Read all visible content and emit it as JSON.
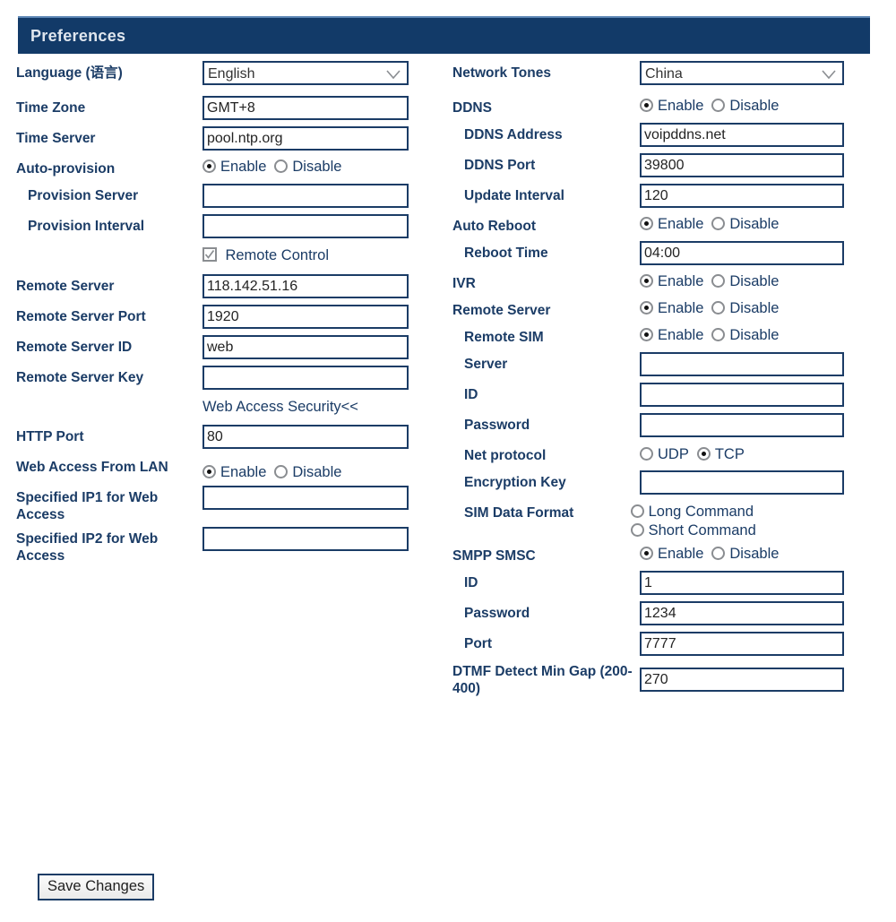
{
  "header": {
    "title": "Preferences",
    "bar_color": "#123a68"
  },
  "theme": {
    "label_color": "#1b3c66",
    "border_color": "#1b3c66",
    "text_color": "#232323"
  },
  "icons": {
    "dropdown": "chevron-down-icon",
    "checkmark": "check-icon"
  },
  "options": {
    "enable": "Enable",
    "disable": "Disable",
    "udp": "UDP",
    "tcp": "TCP",
    "long_command": "Long Command",
    "short_command": "Short Command"
  },
  "left": {
    "language": {
      "label": "Language (语言)",
      "value": "English"
    },
    "time_zone": {
      "label": "Time Zone",
      "value": "GMT+8",
      "placeholder": ""
    },
    "time_server": {
      "label": "Time Server",
      "value": "pool.ntp.org",
      "placeholder": ""
    },
    "auto_provision": {
      "label": "Auto-provision",
      "selected": "Enable"
    },
    "provision_server": {
      "label": "Provision Server",
      "value": "",
      "placeholder": ""
    },
    "provision_interval": {
      "label": "Provision Interval",
      "value": "",
      "placeholder": ""
    },
    "remote_control": {
      "label": "Remote Control",
      "checked": true
    },
    "remote_server": {
      "label": "Remote Server",
      "value": "118.142.51.16",
      "placeholder": ""
    },
    "remote_server_port": {
      "label": "Remote Server Port",
      "value": "1920",
      "placeholder": ""
    },
    "remote_server_id": {
      "label": "Remote Server ID",
      "value": "web",
      "placeholder": ""
    },
    "remote_server_key": {
      "label": "Remote Server Key",
      "value": "",
      "placeholder": ""
    },
    "web_access_security_link": "Web Access Security<<",
    "http_port": {
      "label": "HTTP Port",
      "value": "80",
      "placeholder": ""
    },
    "web_access_from_lan": {
      "label": "Web Access From LAN",
      "selected": "Enable"
    },
    "specified_ip1": {
      "label": "Specified IP1 for Web Access",
      "value": "",
      "placeholder": ""
    },
    "specified_ip2": {
      "label": "Specified IP2 for Web Access",
      "value": "",
      "placeholder": ""
    }
  },
  "right": {
    "network_tones": {
      "label": "Network Tones",
      "value": "China"
    },
    "ddns": {
      "label": "DDNS",
      "selected": "Enable"
    },
    "ddns_address": {
      "label": "DDNS Address",
      "value": "voipddns.net",
      "placeholder": ""
    },
    "ddns_port": {
      "label": "DDNS Port",
      "value": "39800",
      "placeholder": ""
    },
    "update_interval": {
      "label": "Update Interval",
      "value": "120",
      "placeholder": ""
    },
    "auto_reboot": {
      "label": "Auto Reboot",
      "selected": "Enable"
    },
    "reboot_time": {
      "label": "Reboot Time",
      "value": "04:00",
      "placeholder": ""
    },
    "ivr": {
      "label": "IVR",
      "selected": "Enable"
    },
    "remote_server": {
      "label": "Remote Server",
      "selected": "Enable"
    },
    "remote_sim": {
      "label": "Remote SIM",
      "selected": "Enable"
    },
    "server": {
      "label": "Server",
      "value": "",
      "placeholder": ""
    },
    "id": {
      "label": "ID",
      "value": "",
      "placeholder": ""
    },
    "password": {
      "label": "Password",
      "value": "",
      "placeholder": ""
    },
    "net_protocol": {
      "label": "Net protocol",
      "selected": "TCP"
    },
    "encryption_key": {
      "label": "Encryption Key",
      "value": "",
      "placeholder": ""
    },
    "sim_data_format": {
      "label": "SIM Data Format",
      "selected": ""
    },
    "smpp_smsc": {
      "label": "SMPP SMSC",
      "selected": "Enable"
    },
    "smpp_id": {
      "label": "ID",
      "value": "1",
      "placeholder": ""
    },
    "smpp_password": {
      "label": "Password",
      "value": "1234",
      "placeholder": ""
    },
    "smpp_port": {
      "label": "Port",
      "value": "7777",
      "placeholder": ""
    },
    "dtmf_min_gap": {
      "label": "DTMF Detect Min Gap (200-400)",
      "value": "270",
      "placeholder": ""
    }
  },
  "footer": {
    "save_label": "Save Changes"
  }
}
